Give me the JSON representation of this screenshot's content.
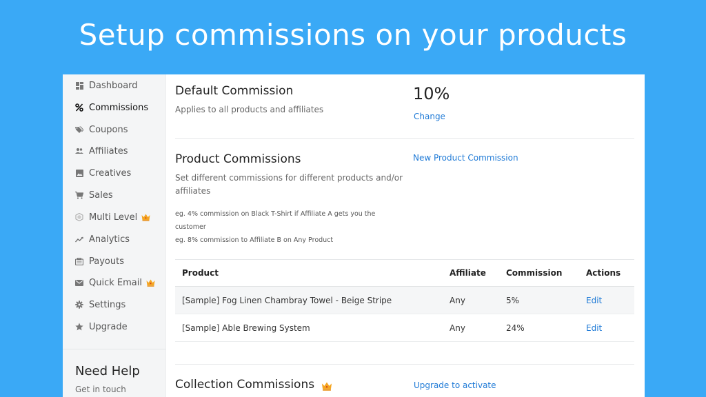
{
  "headline": "Setup commissions on your products",
  "sidebar": {
    "items": [
      {
        "label": "Dashboard",
        "icon": "dashboard-icon"
      },
      {
        "label": "Commissions",
        "icon": "percent-icon",
        "active": true
      },
      {
        "label": "Coupons",
        "icon": "tags-icon"
      },
      {
        "label": "Affiliates",
        "icon": "people-icon"
      },
      {
        "label": "Creatives",
        "icon": "image-icon"
      },
      {
        "label": "Sales",
        "icon": "cart-icon"
      },
      {
        "label": "Multi Level",
        "icon": "multilevel-icon",
        "premium": true
      },
      {
        "label": "Analytics",
        "icon": "trend-icon"
      },
      {
        "label": "Payouts",
        "icon": "payouts-icon"
      },
      {
        "label": "Quick Email",
        "icon": "mail-icon",
        "premium": true
      },
      {
        "label": "Settings",
        "icon": "gear-icon"
      },
      {
        "label": "Upgrade",
        "icon": "star-icon"
      }
    ],
    "help_title": "Need Help",
    "help_sub": "Get in touch"
  },
  "default_commission": {
    "title": "Default Commission",
    "desc": "Applies to all products and affiliates",
    "value": "10%",
    "change_label": "Change"
  },
  "product_commissions": {
    "title": "Product Commissions",
    "desc": "Set different commissions for different products and/or affiliates",
    "note1": "eg. 4% commission on Black T-Shirt if Affiliate A gets you the customer",
    "note2": "eg. 8% commission to Affiliate B on Any Product",
    "new_label": "New Product Commission",
    "columns": [
      "Product",
      "Affiliate",
      "Commission",
      "Actions"
    ],
    "rows": [
      {
        "product": "[Sample] Fog Linen Chambray Towel - Beige Stripe",
        "affiliate": "Any",
        "commission": "5%",
        "action": "Edit"
      },
      {
        "product": "[Sample] Able Brewing System",
        "affiliate": "Any",
        "commission": "24%",
        "action": "Edit"
      }
    ]
  },
  "collection_commissions": {
    "title": "Collection Commissions",
    "upgrade_label": "Upgrade to activate"
  },
  "colors": {
    "background": "#3aa9f6",
    "link": "#1f7ad6",
    "crown": "#f5a623"
  }
}
